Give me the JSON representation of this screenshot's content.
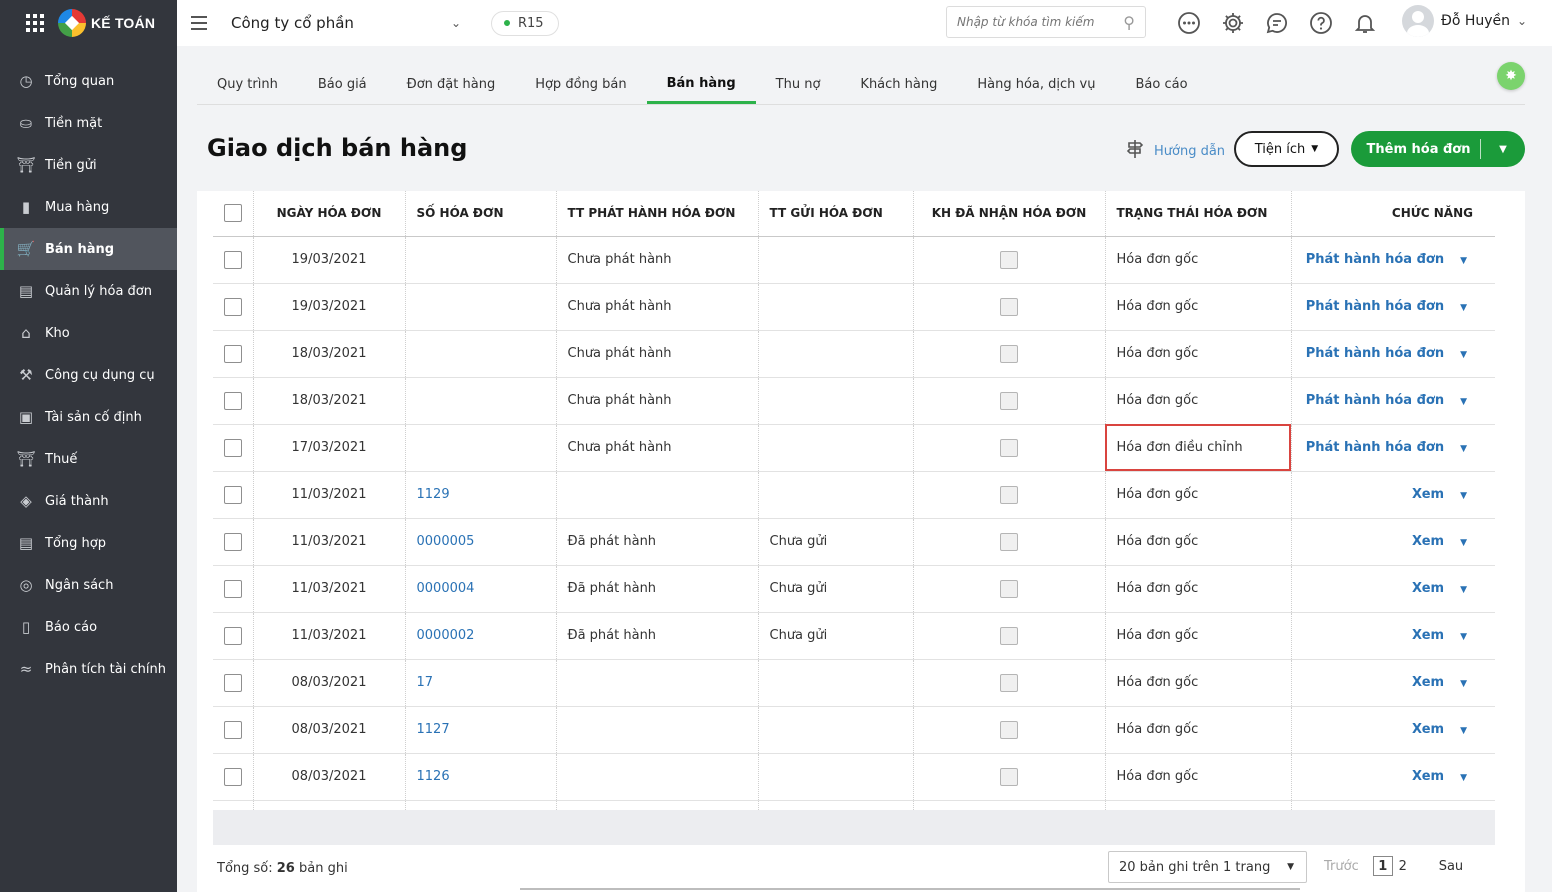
{
  "app": {
    "logo_text": "KẾ TOÁN"
  },
  "sidebar": {
    "items": [
      {
        "label": "Tổng quan",
        "icon": "clock-icon"
      },
      {
        "label": "Tiền mặt",
        "icon": "money-bag-icon"
      },
      {
        "label": "Tiền gửi",
        "icon": "bank-icon"
      },
      {
        "label": "Mua hàng",
        "icon": "shopping-bag-icon"
      },
      {
        "label": "Bán hàng",
        "icon": "cart-icon",
        "active": true
      },
      {
        "label": "Quản lý hóa đơn",
        "icon": "invoice-icon"
      },
      {
        "label": "Kho",
        "icon": "warehouse-icon"
      },
      {
        "label": "Công cụ dụng cụ",
        "icon": "tools-icon"
      },
      {
        "label": "Tài sản cố định",
        "icon": "asset-icon"
      },
      {
        "label": "Thuế",
        "icon": "tax-icon"
      },
      {
        "label": "Giá thành",
        "icon": "price-tag-icon"
      },
      {
        "label": "Tổng hợp",
        "icon": "summary-icon"
      },
      {
        "label": "Ngân sách",
        "icon": "budget-icon"
      },
      {
        "label": "Báo cáo",
        "icon": "bar-chart-icon"
      },
      {
        "label": "Phân tích tài chính",
        "icon": "line-chart-icon"
      }
    ]
  },
  "topbar": {
    "company": "Công ty cổ phần",
    "release": "R15",
    "search_placeholder": "Nhập từ khóa tìm kiếm",
    "user_name": "Đỗ Huyền"
  },
  "tabs": [
    {
      "label": "Quy trình"
    },
    {
      "label": "Báo giá"
    },
    {
      "label": "Đơn đặt hàng"
    },
    {
      "label": "Hợp đồng bán"
    },
    {
      "label": "Bán hàng",
      "active": true
    },
    {
      "label": "Thu nợ"
    },
    {
      "label": "Khách hàng"
    },
    {
      "label": "Hàng hóa, dịch vụ"
    },
    {
      "label": "Báo cáo"
    }
  ],
  "page": {
    "title": "Giao dịch bán hàng",
    "guide_label": "Hướng dẫn",
    "utilities_label": "Tiện ích",
    "add_label": "Thêm hóa đơn"
  },
  "table": {
    "columns": {
      "date": "NGÀY HÓA ĐƠN",
      "number": "SỐ HÓA ĐƠN",
      "issue_status": "TT PHÁT HÀNH HÓA ĐƠN",
      "send_status": "TT GỬI HÓA ĐƠN",
      "received": "KH ĐÃ NHẬN HÓA ĐƠN",
      "invoice_status": "TRẠNG THÁI HÓA ĐƠN",
      "actions": "CHỨC NĂNG"
    },
    "rows": [
      {
        "date": "19/03/2021",
        "number": "",
        "issue": "Chưa phát hành",
        "send": "",
        "status": "Hóa đơn gốc",
        "action": "Phát hành hóa đơn"
      },
      {
        "date": "19/03/2021",
        "number": "",
        "issue": "Chưa phát hành",
        "send": "",
        "status": "Hóa đơn gốc",
        "action": "Phát hành hóa đơn"
      },
      {
        "date": "18/03/2021",
        "number": "",
        "issue": "Chưa phát hành",
        "send": "",
        "status": "Hóa đơn gốc",
        "action": "Phát hành hóa đơn"
      },
      {
        "date": "18/03/2021",
        "number": "",
        "issue": "Chưa phát hành",
        "send": "",
        "status": "Hóa đơn gốc",
        "action": "Phát hành hóa đơn"
      },
      {
        "date": "17/03/2021",
        "number": "",
        "issue": "Chưa phát hành",
        "send": "",
        "status": "Hóa đơn điều chỉnh",
        "action": "Phát hành hóa đơn",
        "highlight": true
      },
      {
        "date": "11/03/2021",
        "number": "1129",
        "issue": "",
        "send": "",
        "status": "Hóa đơn gốc",
        "action": "Xem"
      },
      {
        "date": "11/03/2021",
        "number": "0000005",
        "issue": "Đã phát hành",
        "send": "Chưa gửi",
        "status": "Hóa đơn gốc",
        "action": "Xem"
      },
      {
        "date": "11/03/2021",
        "number": "0000004",
        "issue": "Đã phát hành",
        "send": "Chưa gửi",
        "status": "Hóa đơn gốc",
        "action": "Xem"
      },
      {
        "date": "11/03/2021",
        "number": "0000002",
        "issue": "Đã phát hành",
        "send": "Chưa gửi",
        "status": "Hóa đơn gốc",
        "action": "Xem"
      },
      {
        "date": "08/03/2021",
        "number": "17",
        "issue": "",
        "send": "",
        "status": "Hóa đơn gốc",
        "action": "Xem"
      },
      {
        "date": "08/03/2021",
        "number": "1127",
        "issue": "",
        "send": "",
        "status": "Hóa đơn gốc",
        "action": "Xem"
      },
      {
        "date": "08/03/2021",
        "number": "1126",
        "issue": "",
        "send": "",
        "status": "Hóa đơn gốc",
        "action": "Xem"
      }
    ]
  },
  "footer": {
    "total_label": "Tổng số:",
    "total_count": "26",
    "total_suffix": "bản ghi",
    "per_page": "20 bản ghi trên 1 trang",
    "prev_label": "Trước",
    "pages": [
      "1",
      "2"
    ],
    "current_page": "1",
    "next_label": "Sau"
  },
  "colors": {
    "sidebar_bg": "#33363d",
    "accent_green": "#2db24a",
    "primary_button": "#1b9b3a",
    "link_blue": "#2a72b5",
    "highlight_red": "#d9443f"
  }
}
